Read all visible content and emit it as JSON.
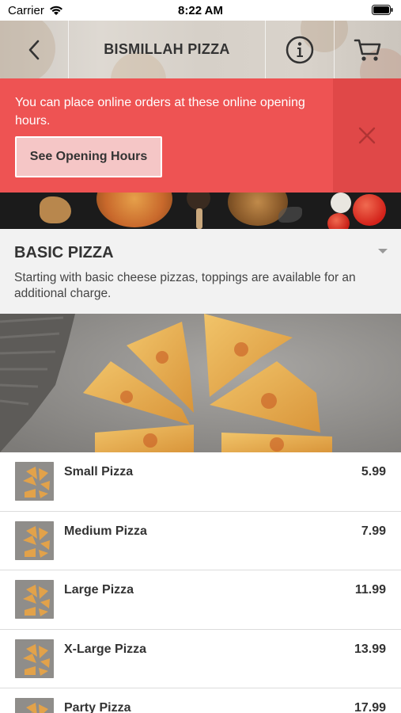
{
  "status_bar": {
    "carrier": "Carrier",
    "time": "8:22 AM"
  },
  "header": {
    "title": "BISMILLAH PIZZA",
    "back_icon": "chevron-left-icon",
    "info_icon": "info-icon",
    "cart_icon": "cart-icon"
  },
  "alert": {
    "message": "You can place online orders at these online opening hours.",
    "button_label": "See Opening Hours",
    "close_icon": "close-icon",
    "color": "#ee5353"
  },
  "category": {
    "title": "BASIC PIZZA",
    "description": "Starting with basic cheese pizzas, toppings are available for an additional charge."
  },
  "menu": {
    "items": [
      {
        "name": "Small Pizza",
        "price": "5.99"
      },
      {
        "name": "Medium Pizza",
        "price": "7.99"
      },
      {
        "name": "Large Pizza",
        "price": "11.99"
      },
      {
        "name": "X-Large Pizza",
        "price": "13.99"
      },
      {
        "name": "Party Pizza",
        "price": "17.99"
      }
    ]
  }
}
